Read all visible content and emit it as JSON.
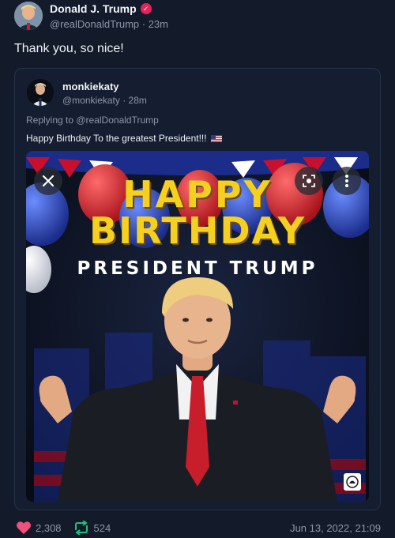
{
  "post": {
    "author_name": "Donald J. Trump",
    "handle_time": "@realDonaldTrump · 23m",
    "text": "Thank you, so nice!"
  },
  "quoted": {
    "author_name": "monkiekaty",
    "handle_time": "@monkiekaty · 28m",
    "replying_to": "Replying to @realDonaldTrump",
    "text": "Happy Birthday To the greatest President!!!",
    "image": {
      "line1": "HAPPY",
      "line2": "BIRTHDAY",
      "line3": "PRESIDENT TRUMP"
    }
  },
  "footer": {
    "likes": "2,308",
    "reposts": "524",
    "timestamp": "Jun 13, 2022, 21:09"
  },
  "icons": {
    "verified": "verified-badge-icon",
    "like": "heart-icon",
    "repost": "repost-icon",
    "close": "close-icon",
    "lens": "lens-search-icon",
    "more": "more-vertical-icon"
  },
  "colors": {
    "background": "#131b2b",
    "like": "#f0507a",
    "repost": "#20c07a",
    "verified": "#e0245e",
    "headline": "#f5d01e"
  }
}
